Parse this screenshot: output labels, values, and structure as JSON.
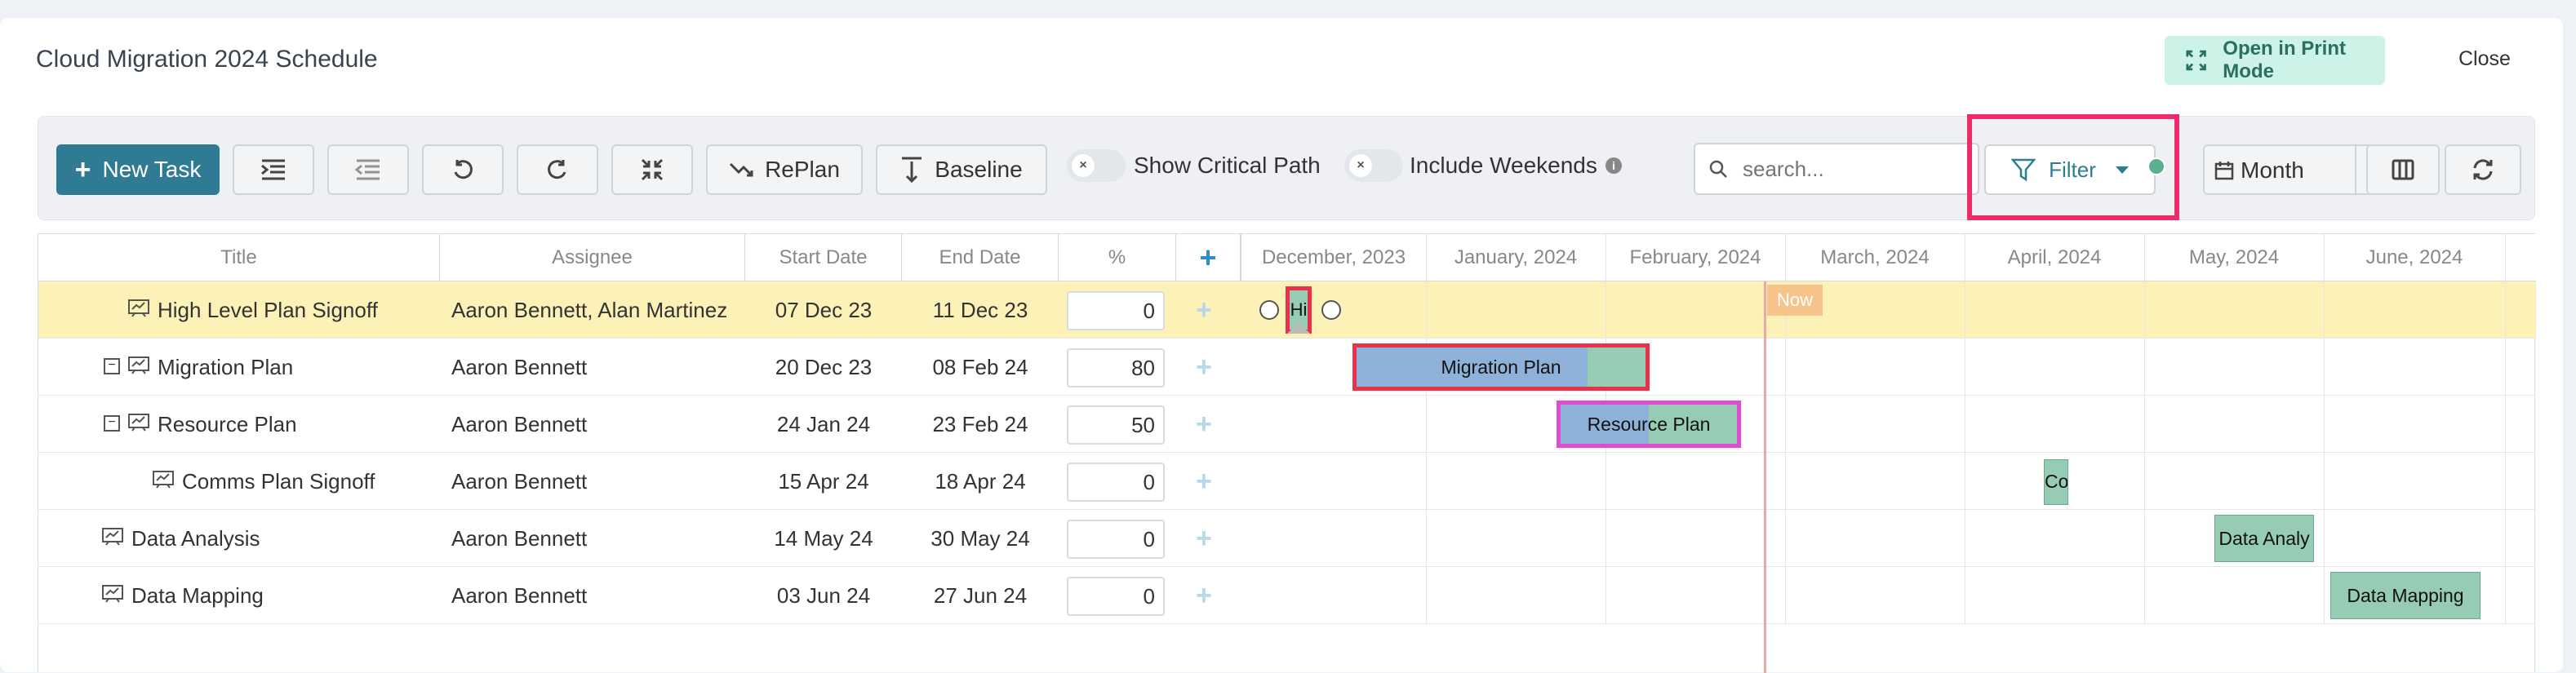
{
  "window": {
    "title": "Cloud Migration 2024 Schedule",
    "print_mode_label": "Open in Print Mode",
    "close_label": "Close"
  },
  "toolbar": {
    "new_task_label": "New Task",
    "replan_label": "RePlan",
    "baseline_label": "Baseline",
    "show_critical_path_label": "Show Critical Path",
    "include_weekends_label": "Include Weekends",
    "search_placeholder": "search...",
    "filter_label": "Filter",
    "view_label": "Month"
  },
  "grid": {
    "columns": [
      "Title",
      "Assignee",
      "Start Date",
      "End Date",
      "%"
    ],
    "rows": [
      {
        "title": "High Level Plan Signoff",
        "assignee": "Aaron Bennett, Alan Martinez",
        "start": "07 Dec 23",
        "end": "11 Dec 23",
        "pct": "0"
      },
      {
        "title": "Migration Plan",
        "assignee": "Aaron Bennett",
        "start": "20 Dec 23",
        "end": "08 Feb 24",
        "pct": "80"
      },
      {
        "title": "Resource Plan",
        "assignee": "Aaron Bennett",
        "start": "24 Jan 24",
        "end": "23 Feb 24",
        "pct": "50"
      },
      {
        "title": "Comms Plan Signoff",
        "assignee": "Aaron Bennett",
        "start": "15 Apr 24",
        "end": "18 Apr 24",
        "pct": "0"
      },
      {
        "title": "Data Analysis",
        "assignee": "Aaron Bennett",
        "start": "14 May 24",
        "end": "30 May 24",
        "pct": "0"
      },
      {
        "title": "Data Mapping",
        "assignee": "Aaron Bennett",
        "start": "03 Jun 24",
        "end": "27 Jun 24",
        "pct": "0"
      }
    ]
  },
  "timeline": {
    "months": [
      "December, 2023",
      "January, 2024",
      "February, 2024",
      "March, 2024",
      "April, 2024",
      "May, 2024",
      "June, 2024"
    ],
    "now_label": "Now",
    "bars": {
      "b0": "Hi",
      "b1": "Migration Plan",
      "b2": "Resource Plan",
      "b3": "Co",
      "b4": "Data Analy",
      "b5": "Data Mapping"
    }
  },
  "colors": {
    "primary": "#2f7b94",
    "accent": "#5aaf8c",
    "highlight_row": "#fcf1b6",
    "critical": "#e8324b",
    "selected": "#e04bd0",
    "bar_blue": "#8eb1d9",
    "bar_green": "#97ccb4"
  }
}
